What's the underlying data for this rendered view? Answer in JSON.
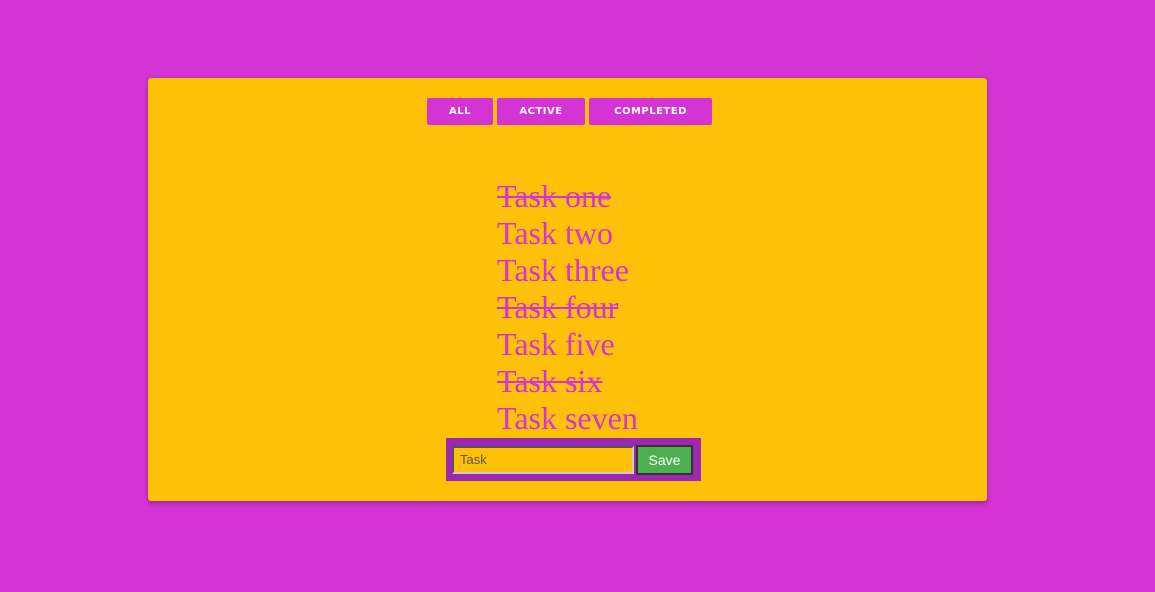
{
  "filters": {
    "all_label": "ALL",
    "active_label": "ACTIVE",
    "completed_label": "COMPLETED"
  },
  "tasks": [
    {
      "label": "Task one",
      "completed": true
    },
    {
      "label": "Task two",
      "completed": false
    },
    {
      "label": "Task three",
      "completed": false
    },
    {
      "label": "Task four",
      "completed": true
    },
    {
      "label": "Task five",
      "completed": false
    },
    {
      "label": "Task six",
      "completed": true
    },
    {
      "label": "Task seven",
      "completed": false
    }
  ],
  "form": {
    "input_value": "",
    "input_placeholder": "Task",
    "save_label": "Save"
  },
  "colors": {
    "page_background": "#d334d3",
    "card_background": "#ffc107",
    "accent": "#d334d3",
    "form_background": "#9c27b0",
    "save_button": "#4caf50"
  }
}
